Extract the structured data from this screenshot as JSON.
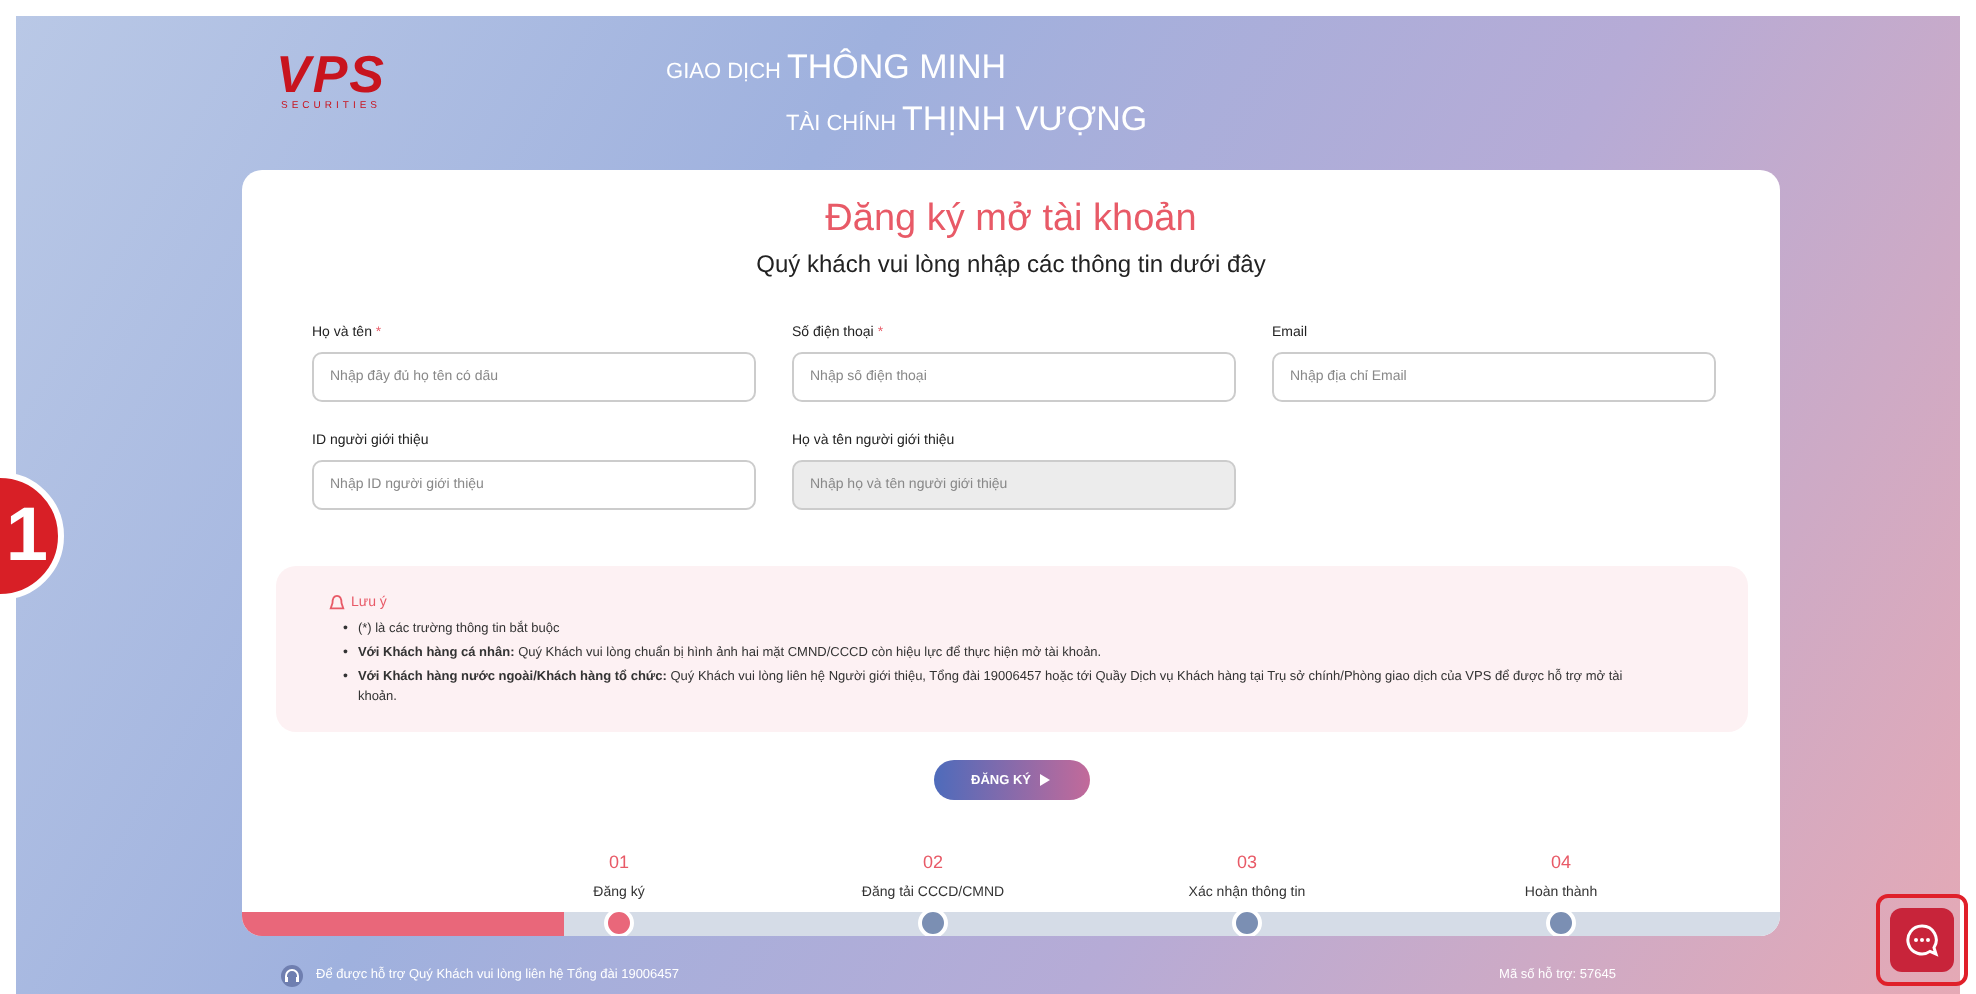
{
  "header": {
    "logo": "VPS",
    "logo_sub": "SECURITIES",
    "slogan_1_small": "GIAO DỊCH",
    "slogan_1_big": "THÔNG MINH",
    "slogan_2_small": "TÀI CHÍNH",
    "slogan_2_big": "THỊNH VƯỢNG"
  },
  "callout_badge": "1",
  "form": {
    "title": "Đăng ký mở tài khoản",
    "subtitle": "Quý khách vui lòng nhập các thông tin dưới đây",
    "fields": [
      {
        "label": "Họ và tên",
        "required": true,
        "placeholder": "Nhập đầy đủ họ tên có dấu",
        "disabled": false
      },
      {
        "label": "Số điện thoại",
        "required": true,
        "placeholder": "Nhập số điện thoại",
        "disabled": false
      },
      {
        "label": "Email",
        "required": false,
        "placeholder": "Nhập địa chỉ Email",
        "disabled": false
      },
      {
        "label": "ID người giới thiệu",
        "required": false,
        "placeholder": "Nhập ID người giới thiệu",
        "disabled": false
      },
      {
        "label": "Họ và tên người giới thiệu",
        "required": false,
        "placeholder": "Nhập họ và tên người giới thiệu",
        "disabled": true
      }
    ],
    "required_mark": "*",
    "note": {
      "title": "Lưu ý",
      "bullet": "•",
      "items": [
        "(*) là các trường thông tin bắt buộc",
        "**Với Khách hàng cá nhân:** Quý Khách vui lòng chuẩn bị hình ảnh hai mặt CMND/CCCD còn hiệu lực để thực hiện mở tài khoản.",
        "**Với Khách hàng nước ngoài/Khách hàng tổ chức:** Quý Khách vui lòng liên hệ Người giới thiệu, Tổng đài 19006457 hoặc tới Quầy Dịch vụ Khách hàng tại Trụ sở chính/Phòng giao dịch của VPS để được hỗ trợ mở tài khoản."
      ]
    },
    "submit": "ĐĂNG KÝ"
  },
  "steps": {
    "level": 0.21,
    "items": [
      {
        "number": "01",
        "label": "Đăng ký",
        "selected": true
      },
      {
        "number": "02",
        "label": "Đăng tải CCCD/CMND",
        "selected": false
      },
      {
        "number": "03",
        "label": "Xác nhận thông tin",
        "selected": false
      },
      {
        "number": "04",
        "label": "Hoàn thành",
        "selected": false
      }
    ]
  },
  "footer": {
    "support": "Để được hỗ trợ Quý Khách vui lòng liên hệ Tổng đài 19006457",
    "code": "Mã số hỗ trợ: 57645"
  }
}
